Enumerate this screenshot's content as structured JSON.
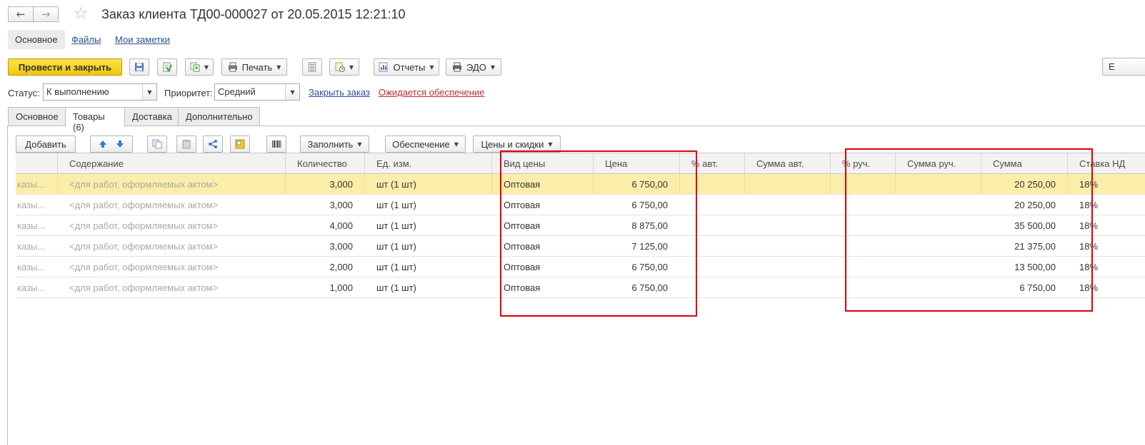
{
  "window": {
    "title": "Заказ клиента ТД00-000027 от 20.05.2015 12:21:10"
  },
  "nav": {
    "back": "←",
    "forward": "→",
    "star": "☆"
  },
  "top_links": {
    "main": "Основное",
    "files": "Файлы",
    "notes": "Мои заметки"
  },
  "toolbar": {
    "post_close": "Провести и закрыть",
    "print": "Печать",
    "reports": "Отчеты",
    "edo": "ЭДО",
    "cut_right": "Е"
  },
  "form": {
    "status_label": "Статус:",
    "status_value": "К выполнению",
    "priority_label": "Приоритет:",
    "priority_value": "Средний",
    "close_order": "Закрыть заказ",
    "awaiting": "Ожидается обеспечение"
  },
  "tabs": [
    {
      "label": "Основное"
    },
    {
      "label": "Товары (6)"
    },
    {
      "label": "Доставка"
    },
    {
      "label": "Дополнительно"
    }
  ],
  "table_toolbar": {
    "add": "Добавить",
    "fill": "Заполнить",
    "supply": "Обеспечение",
    "prices": "Цены и скидки"
  },
  "columns": {
    "content": "Содержание",
    "qty": "Количество",
    "unit": "Ед. изм.",
    "price_type": "Вид цены",
    "price": "Цена",
    "auto_pct": "% авт.",
    "auto_sum": "Сумма авт.",
    "manual_pct": "% руч.",
    "manual_sum": "Сумма руч.",
    "sum": "Сумма",
    "vat": "Ставка НД"
  },
  "rows": [
    {
      "prefix": "казы...",
      "content": "<для работ, оформляемых актом>",
      "qty": "3,000",
      "unit": "шт (1 шт)",
      "price_type": "Оптовая",
      "price": "6 750,00",
      "sum": "20 250,00",
      "vat": "18%"
    },
    {
      "prefix": "казы...",
      "content": "<для работ, оформляемых актом>",
      "qty": "3,000",
      "unit": "шт (1 шт)",
      "price_type": "Оптовая",
      "price": "6 750,00",
      "sum": "20 250,00",
      "vat": "18%"
    },
    {
      "prefix": "казы...",
      "content": "<для работ, оформляемых актом>",
      "qty": "4,000",
      "unit": "шт (1 шт)",
      "price_type": "Оптовая",
      "price": "8 875,00",
      "sum": "35 500,00",
      "vat": "18%"
    },
    {
      "prefix": "казы...",
      "content": "<для работ, оформляемых актом>",
      "qty": "3,000",
      "unit": "шт (1 шт)",
      "price_type": "Оптовая",
      "price": "7 125,00",
      "sum": "21 375,00",
      "vat": "18%"
    },
    {
      "prefix": "казы...",
      "content": "<для работ, оформляемых актом>",
      "qty": "2,000",
      "unit": "шт (1 шт)",
      "price_type": "Оптовая",
      "price": "6 750,00",
      "sum": "13 500,00",
      "vat": "18%"
    },
    {
      "prefix": "казы...",
      "content": "<для работ, оформляемых актом>",
      "qty": "1,000",
      "unit": "шт (1 шт)",
      "price_type": "Оптовая",
      "price": "6 750,00",
      "sum": "6 750,00",
      "vat": "18%"
    }
  ],
  "colors": {
    "primary_button": "#f3c708",
    "selected_row": "#fbeeaa",
    "link": "#2b4f92",
    "warning_link": "#c62a2a",
    "highlight_box": "#e00000"
  }
}
